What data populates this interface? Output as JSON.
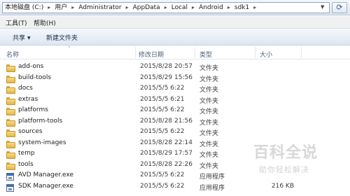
{
  "address": {
    "breadcrumbs": [
      "本地磁盘 (C:)",
      "用户",
      "Administrator",
      "AppData",
      "Local",
      "Android",
      "sdk1"
    ],
    "dropdown_icon": "chevron-down-icon",
    "refresh_icon": "refresh-icon",
    "refresh_glyph": "⟳"
  },
  "menubar": {
    "tools": "工具(T)",
    "help": "帮助(H)"
  },
  "commandbar": {
    "share": "共享",
    "new_folder": "新建文件夹"
  },
  "columns": {
    "name": "名称",
    "date": "修改日期",
    "type": "类型",
    "size": "大小"
  },
  "files": [
    {
      "name": "add-ons",
      "date": "2015/8/28 20:57",
      "type": "文件夹",
      "size": "",
      "icon": "folder-icon"
    },
    {
      "name": "build-tools",
      "date": "2015/8/29 15:56",
      "type": "文件夹",
      "size": "",
      "icon": "folder-icon"
    },
    {
      "name": "docs",
      "date": "2015/5/5 6:22",
      "type": "文件夹",
      "size": "",
      "icon": "folder-icon"
    },
    {
      "name": "extras",
      "date": "2015/5/5 6:21",
      "type": "文件夹",
      "size": "",
      "icon": "folder-icon"
    },
    {
      "name": "platforms",
      "date": "2015/5/5 6:22",
      "type": "文件夹",
      "size": "",
      "icon": "folder-icon"
    },
    {
      "name": "platform-tools",
      "date": "2015/8/28 21:56",
      "type": "文件夹",
      "size": "",
      "icon": "folder-icon"
    },
    {
      "name": "sources",
      "date": "2015/5/5 6:22",
      "type": "文件夹",
      "size": "",
      "icon": "folder-icon"
    },
    {
      "name": "system-images",
      "date": "2015/8/28 22:14",
      "type": "文件夹",
      "size": "",
      "icon": "folder-icon"
    },
    {
      "name": "temp",
      "date": "2015/8/29 17:57",
      "type": "文件夹",
      "size": "",
      "icon": "folder-icon"
    },
    {
      "name": "tools",
      "date": "2015/8/28 22:26",
      "type": "文件夹",
      "size": "",
      "icon": "folder-icon"
    },
    {
      "name": "AVD Manager.exe",
      "date": "2015/5/5 6:22",
      "type": "应用程序",
      "size": "",
      "icon": "exe-icon"
    },
    {
      "name": "SDK Manager.exe",
      "date": "2015/5/5 6:22",
      "type": "应用程序",
      "size": "216 KB",
      "icon": "exe-icon"
    }
  ],
  "watermark": {
    "title": "百科全说",
    "subtitle": "助你轻松解决"
  }
}
